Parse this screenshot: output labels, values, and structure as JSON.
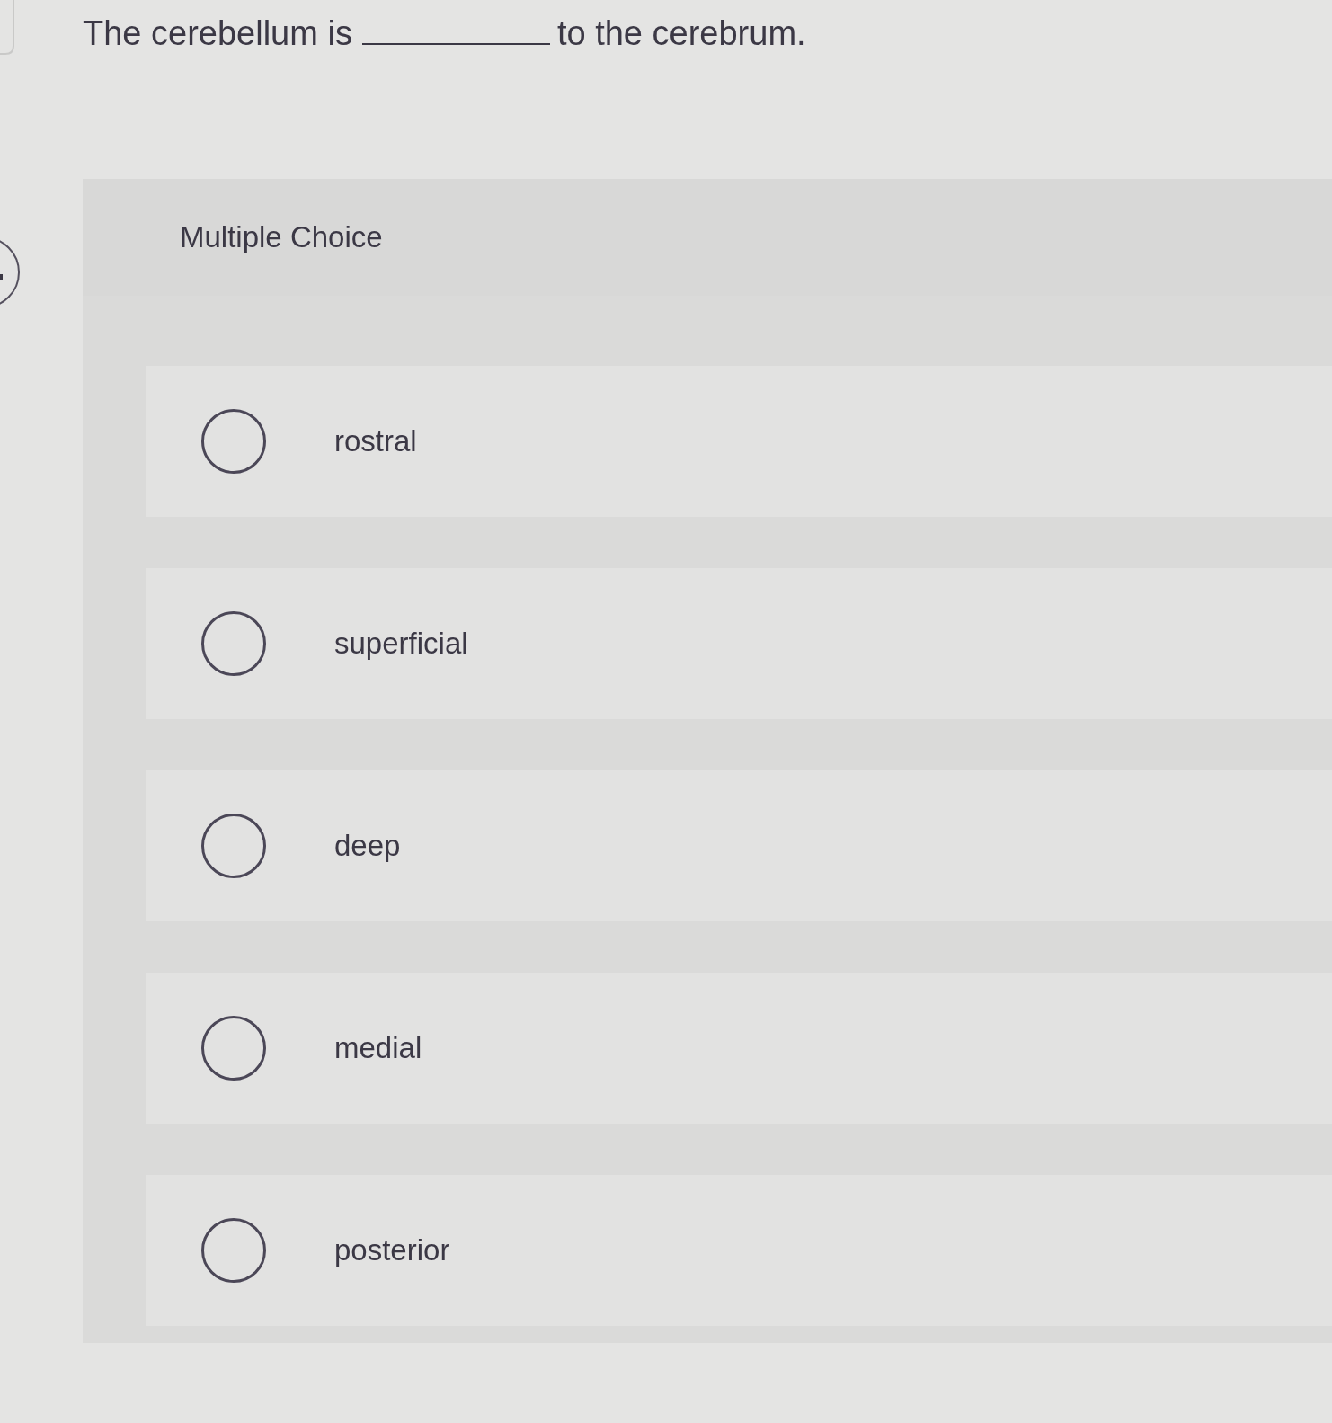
{
  "question": {
    "before": "The cerebellum is",
    "after": "to the cerebrum."
  },
  "panel": {
    "type_label": "Multiple Choice",
    "options": [
      {
        "label": "rostral",
        "selected": false
      },
      {
        "label": "superficial",
        "selected": false
      },
      {
        "label": "deep",
        "selected": false
      },
      {
        "label": "medial",
        "selected": false
      },
      {
        "label": "posterior",
        "selected": false
      }
    ]
  }
}
